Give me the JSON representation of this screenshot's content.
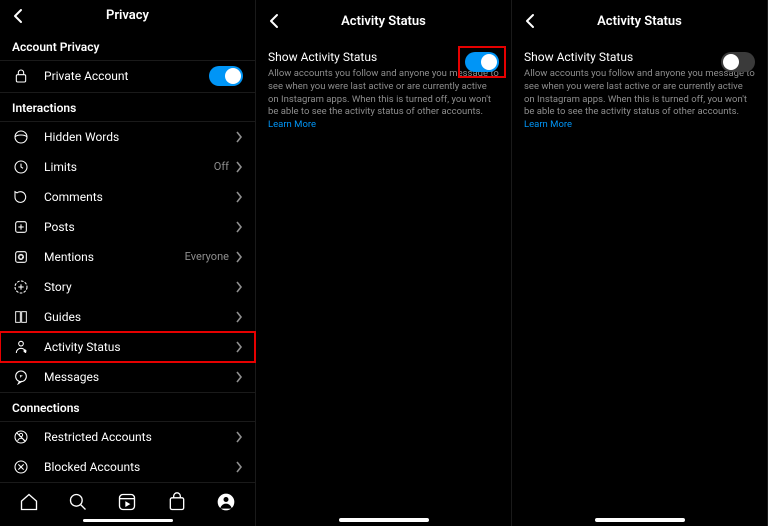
{
  "panel1": {
    "title": "Privacy",
    "section_account": "Account Privacy",
    "private_account": "Private Account",
    "section_interactions": "Interactions",
    "items": {
      "hidden_words": "Hidden Words",
      "limits": "Limits",
      "limits_aux": "Off",
      "comments": "Comments",
      "posts": "Posts",
      "mentions": "Mentions",
      "mentions_aux": "Everyone",
      "story": "Story",
      "guides": "Guides",
      "activity_status": "Activity Status",
      "messages": "Messages"
    },
    "section_connections": "Connections",
    "restricted": "Restricted Accounts",
    "blocked": "Blocked Accounts"
  },
  "panel2": {
    "title": "Activity Status",
    "show_label": "Show Activity Status",
    "desc": "Allow accounts you follow and anyone you message to see when you were last active or are currently active on Instagram apps. When this is turned off, you won't be able to see the activity status of other accounts.",
    "learn": "Learn More"
  },
  "panel3": {
    "title": "Activity Status",
    "show_label": "Show Activity Status",
    "desc": "Allow accounts you follow and anyone you message to see when you were last active or are currently active on Instagram apps. When this is turned off, you won't be able to see the activity status of other accounts.",
    "learn": "Learn More"
  }
}
